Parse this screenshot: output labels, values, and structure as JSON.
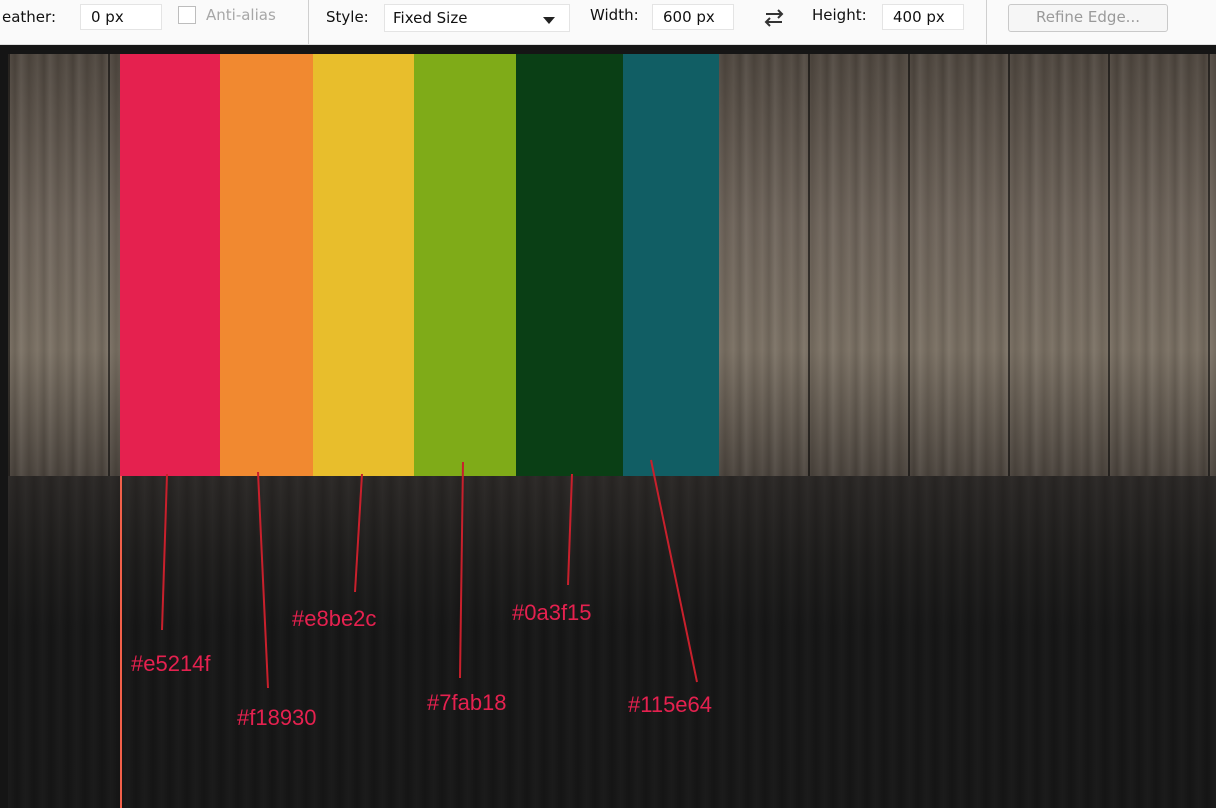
{
  "options_bar": {
    "feather_label": "eather:",
    "feather_value": "0 px",
    "anti_alias_label": "Anti-alias",
    "style_label": "Style:",
    "style_value": "Fixed Size",
    "width_label": "Width:",
    "width_value": "600 px",
    "height_label": "Height:",
    "height_value": "400 px",
    "refine_edge_label": "Refine Edge..."
  },
  "colors": {
    "label_color": "#e5214f",
    "line_color": "#c8202c",
    "guide_color": "#f2604a"
  },
  "swatches": [
    {
      "hex": "#e5214f",
      "label": "#e5214f"
    },
    {
      "hex": "#f18930",
      "label": "#f18930"
    },
    {
      "hex": "#e8be2c",
      "label": "#e8be2c"
    },
    {
      "hex": "#7fab18",
      "label": "#7fab18"
    },
    {
      "hex": "#0a3f15",
      "label": "#0a3f15"
    },
    {
      "hex": "#115e64",
      "label": "#115e64"
    }
  ]
}
